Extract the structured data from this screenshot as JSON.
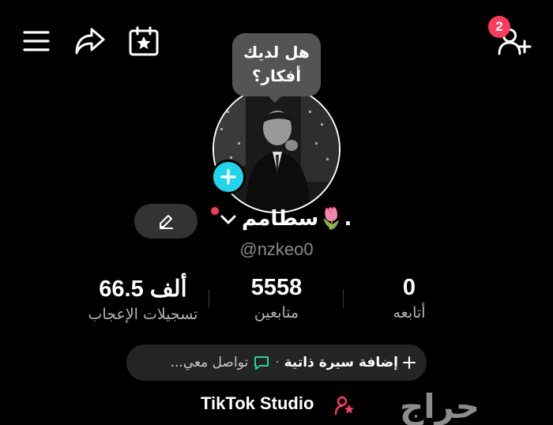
{
  "top_bar": {
    "left_icons": [
      "menu-icon",
      "share-icon",
      "calendar-star-icon"
    ],
    "right_icon": "add-friend-icon",
    "notification_count": "2"
  },
  "profile": {
    "idea_bubble": {
      "line1": "هل لديك",
      "line2": "أفكار؟"
    },
    "display_name": "سطامم🌷.",
    "username": "@nzkeo0"
  },
  "stats": {
    "likes": {
      "value": "66.5 ألف",
      "label": "تسجيلات الإعجاب"
    },
    "followers": {
      "value": "5558",
      "label": "متابعين"
    },
    "following": {
      "value": "0",
      "label": "أتابعه"
    }
  },
  "bio": {
    "add_label": "إضافة سيرة ذاتية",
    "separator": "·",
    "contact_label": "تواصل معي..."
  },
  "studio": {
    "label": "TikTok Studio"
  },
  "watermark": {
    "text": "حراج"
  },
  "colors": {
    "background": "#000000",
    "accent_cyan": "#20d5ec",
    "badge_red": "#ff3b5c",
    "pill": "#242424"
  }
}
